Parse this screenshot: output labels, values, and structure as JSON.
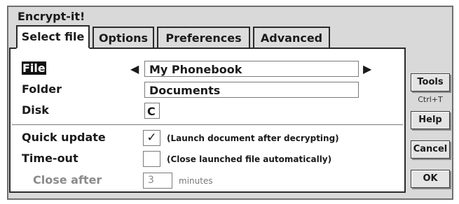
{
  "window": {
    "title": "Encrypt-it!"
  },
  "tabs": [
    {
      "label": "Select file",
      "active": true
    },
    {
      "label": "Options",
      "active": false
    },
    {
      "label": "Preferences",
      "active": false
    },
    {
      "label": "Advanced",
      "active": false
    }
  ],
  "form": {
    "file": {
      "label": "File",
      "value": "My Phonebook",
      "prev_icon": "triangle-left-icon",
      "next_icon": "triangle-right-icon"
    },
    "folder": {
      "label": "Folder",
      "value": "Documents"
    },
    "disk": {
      "label": "Disk",
      "value": "C"
    },
    "quick_update": {
      "label": "Quick update",
      "checked": true,
      "check_mark": "✓",
      "hint": "(Launch document after decrypting)"
    },
    "timeout": {
      "label": "Time-out",
      "checked": false,
      "hint": "(Close launched file automatically)"
    },
    "close_after": {
      "label": "Close after",
      "value": "3",
      "unit": "minutes"
    }
  },
  "buttons": {
    "tools": "Tools",
    "tools_shortcut": "Ctrl+T",
    "help": "Help",
    "cancel": "Cancel",
    "ok": "OK"
  }
}
